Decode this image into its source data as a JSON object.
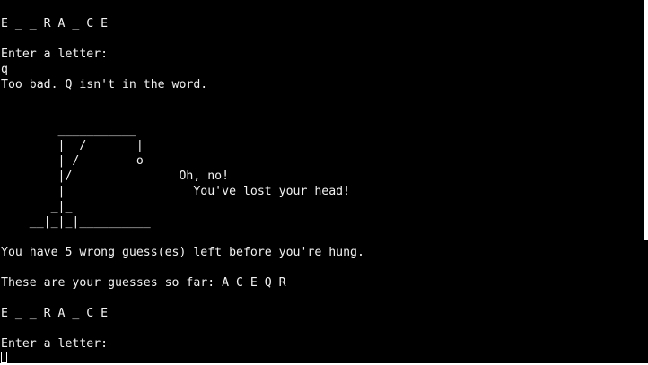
{
  "terminal": {
    "lines": [
      "E _ _ R A _ C E",
      "Enter a letter:",
      "q",
      "Too bad. Q isn't in the word.",
      "        ___________",
      "        |  /       |",
      "        | /        o",
      "        |/               Oh, no!",
      "        |                  You've lost your head!",
      "       _|_",
      "    __|_|_|__________",
      "You have 5 wrong guess(es) left before you're hung.",
      "These are your guesses so far: A C E Q R",
      "E _ _ R A _ C E",
      "Enter a letter:"
    ]
  },
  "colors": {
    "background": "#000000",
    "text": "#f2f2f2",
    "cursor": "#ffffff"
  }
}
